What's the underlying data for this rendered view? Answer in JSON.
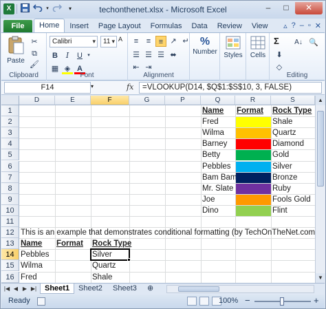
{
  "window": {
    "title": "techonthenet.xlsx - Microsoft Excel",
    "buttons": {
      "minimize": "–",
      "maximize": "□",
      "close": "✕"
    }
  },
  "qat": {
    "logo": "X",
    "save_icon": "save-icon",
    "undo_icon": "undo-icon",
    "redo_icon": "redo-icon"
  },
  "ribbon_tabs": [
    "File",
    "Home",
    "Insert",
    "Page Layout",
    "Formulas",
    "Data",
    "Review",
    "View"
  ],
  "active_tab": "Home",
  "ribbon": {
    "clipboard": {
      "label": "Clipboard",
      "paste": "Paste"
    },
    "font": {
      "label": "Font",
      "font_name": "Calibri",
      "font_size": "11",
      "bold": "B",
      "italic": "I",
      "underline": "U"
    },
    "alignment": {
      "label": "Alignment"
    },
    "number": {
      "label": "Number"
    },
    "styles": {
      "label": "Styles"
    },
    "cells": {
      "label": "Cells"
    },
    "editing": {
      "label": "Editing",
      "sum": "Σ"
    }
  },
  "formula_bar": {
    "name_box": "F14",
    "fx": "fx",
    "formula": "=VLOOKUP(D14, $Q$1:$S$10, 3, FALSE)"
  },
  "grid": {
    "columns": [
      "D",
      "E",
      "F",
      "G",
      "P",
      "Q",
      "R",
      "S"
    ],
    "selected_column": "F",
    "rows": [
      "1",
      "2",
      "3",
      "4",
      "5",
      "6",
      "7",
      "8",
      "9",
      "10",
      "11",
      "12",
      "13",
      "14",
      "15",
      "16"
    ],
    "selected_row": "14",
    "lookup_headers": {
      "name": "Name",
      "format": "Format",
      "rock_type": "Rock Type"
    },
    "lookup_table": [
      {
        "name": "Fred",
        "color": "#FFFF00",
        "rock": "Shale"
      },
      {
        "name": "Wilma",
        "color": "#FFC000",
        "rock": "Quartz"
      },
      {
        "name": "Barney",
        "color": "#FF0000",
        "rock": "Diamond"
      },
      {
        "name": "Betty",
        "color": "#00B050",
        "rock": "Gold"
      },
      {
        "name": "Pebbles",
        "color": "#00B0F0",
        "rock": "Silver"
      },
      {
        "name": "Bam Bam",
        "color": "#002060",
        "rock": "Bronze"
      },
      {
        "name": "Mr. Slate",
        "color": "#7030A0",
        "rock": "Ruby"
      },
      {
        "name": "Joe",
        "color": "#FF9900",
        "rock": "Fools Gold"
      },
      {
        "name": "Dino",
        "color": "#92D050",
        "rock": "Flint"
      }
    ],
    "note": "This is an example that demonstrates conditional formatting (by TechOnTheNet.com)",
    "results_headers": {
      "name": "Name",
      "format": "Format",
      "rock_type": "Rock Type"
    },
    "results": [
      {
        "name": "Pebbles",
        "rock": "Silver"
      },
      {
        "name": "Wilma",
        "rock": "Quartz"
      },
      {
        "name": "Fred",
        "rock": "Shale"
      }
    ]
  },
  "sheets": [
    "Sheet1",
    "Sheet2",
    "Sheet3"
  ],
  "active_sheet": "Sheet1",
  "status": {
    "ready": "Ready",
    "zoom": "100%",
    "minus": "−",
    "plus": "+"
  }
}
